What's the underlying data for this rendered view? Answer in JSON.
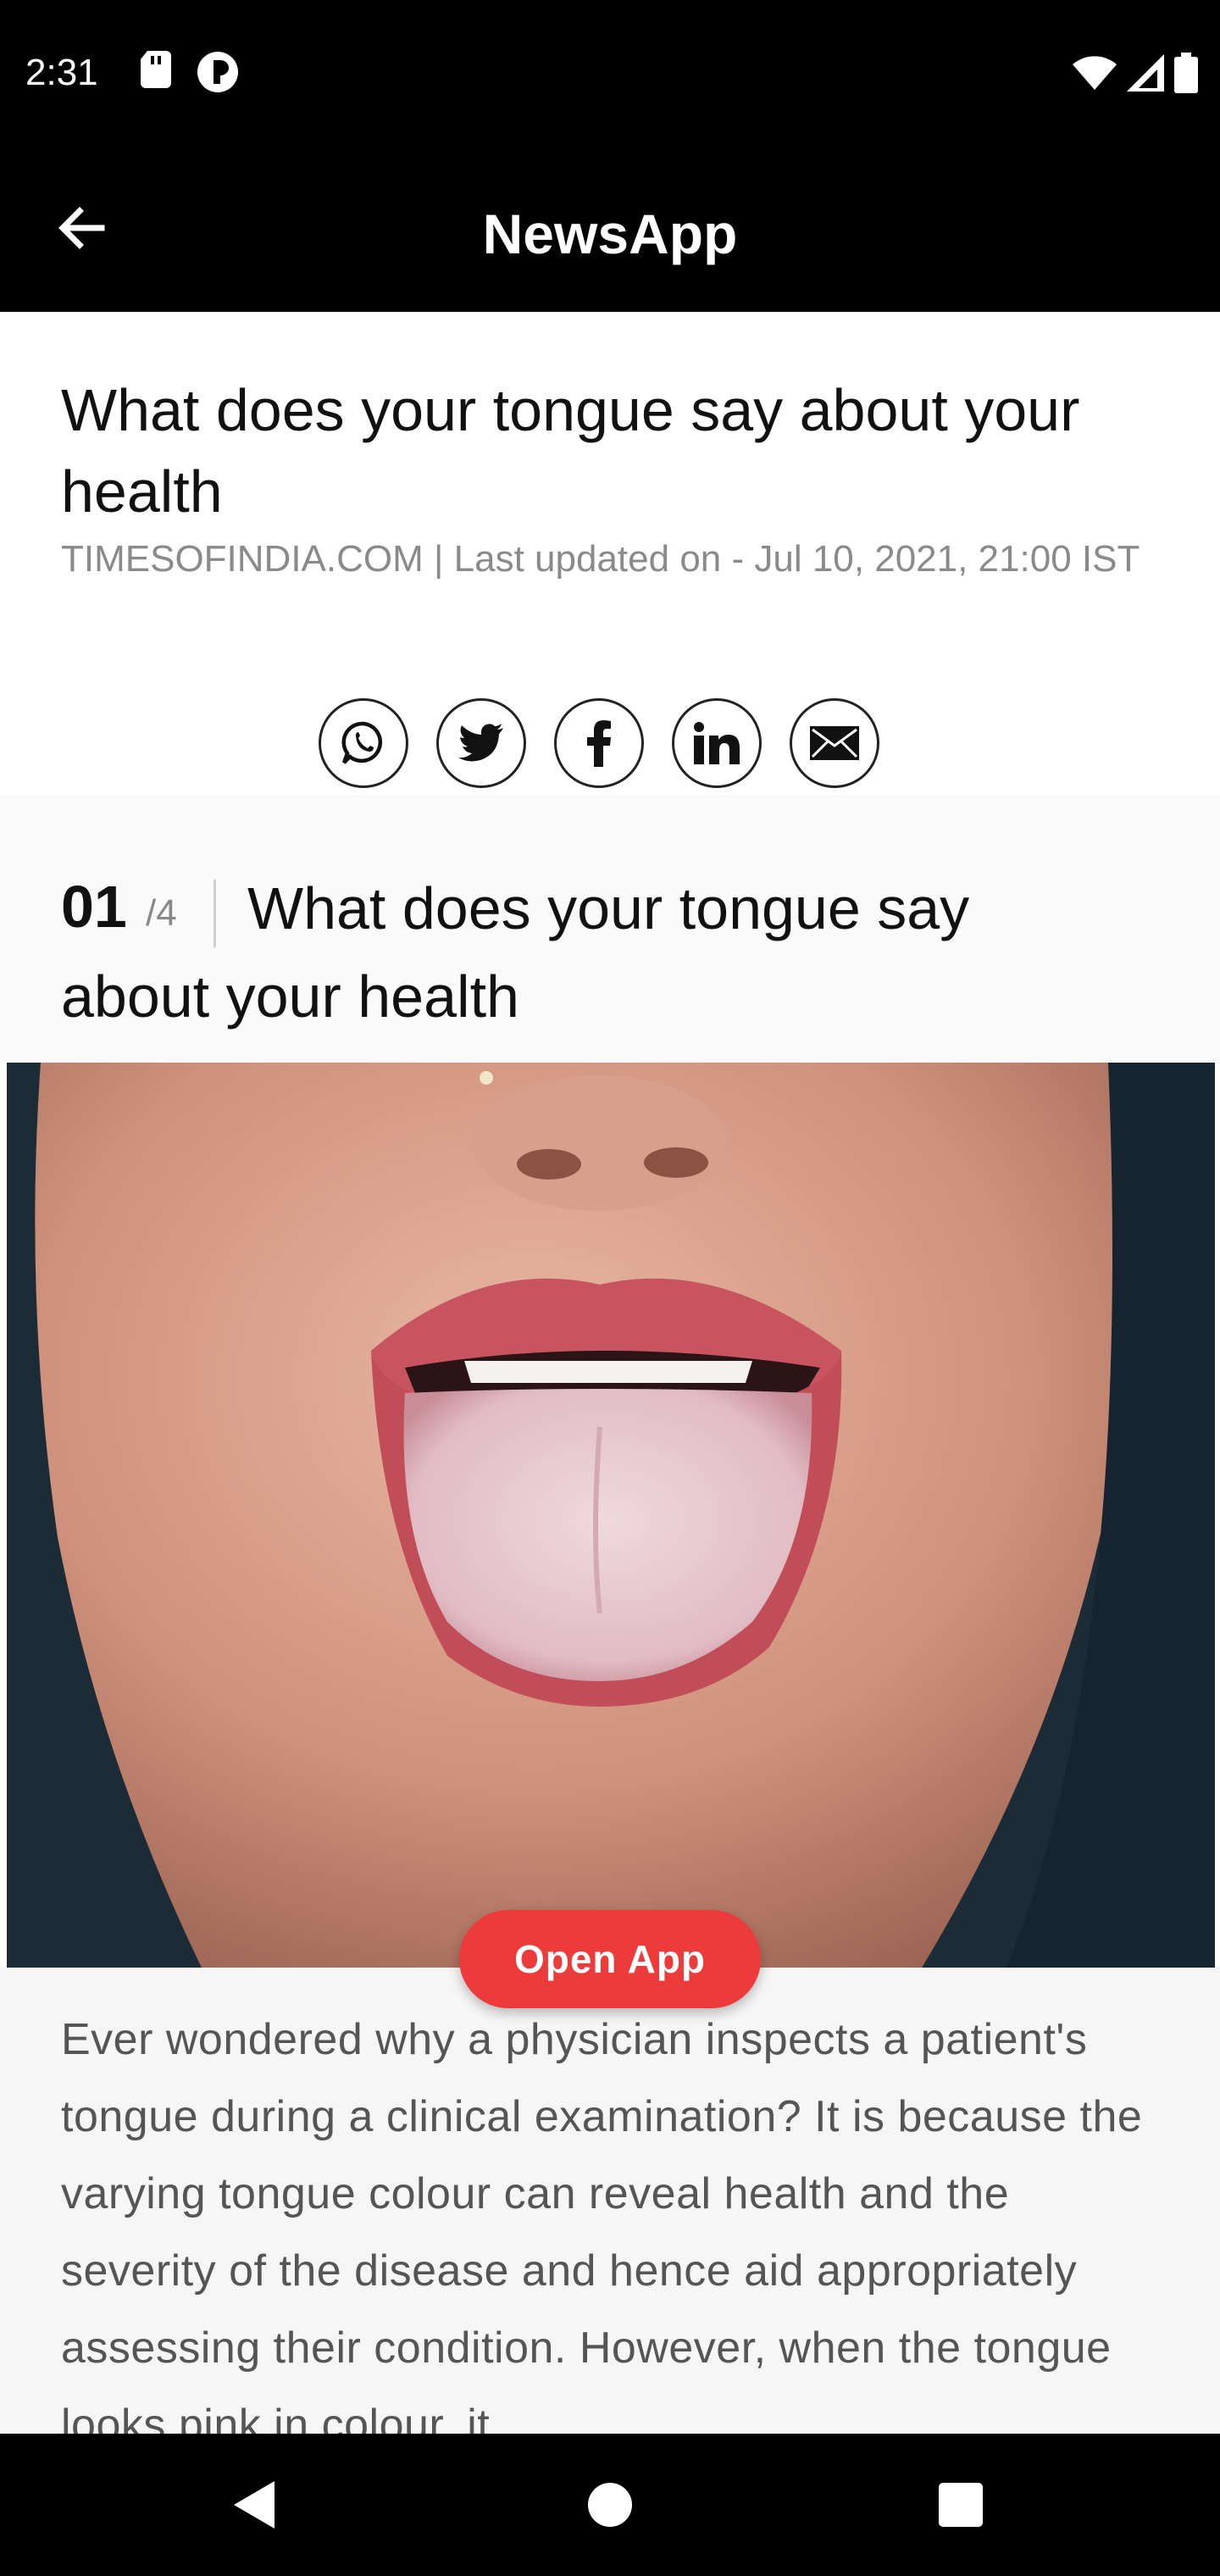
{
  "status_bar": {
    "time": "2:31",
    "left_icons": [
      "sd-card-icon",
      "vpn-key-icon"
    ],
    "right_icons": [
      "wifi-icon",
      "cell-signal-icon",
      "battery-icon"
    ]
  },
  "app_bar": {
    "title": "NewsApp",
    "back_icon": "arrow-left-icon"
  },
  "article": {
    "headline": "What does your tongue say about your health",
    "meta": "TIMESOFINDIA.COM | Last updated on - Jul 10, 2021, 21:00 IST",
    "share_buttons": [
      "whatsapp-icon",
      "twitter-icon",
      "facebook-icon",
      "linkedin-icon",
      "email-icon"
    ]
  },
  "slide": {
    "number": "01",
    "total": "/4",
    "title": "What does your tongue say about your health",
    "body": "Ever wondered why a physician inspects a patient's tongue during a clinical examination? It is because the varying tongue colour can reveal health and the severity of the disease and hence aid appropriately assessing their condition. However, when the tongue looks pink in colour, it"
  },
  "cta": {
    "open_app_label": "Open App",
    "color": "#ed3b3b"
  },
  "nav_bar": {
    "icons": [
      "back-triangle-icon",
      "home-circle-icon",
      "recents-square-icon"
    ]
  }
}
